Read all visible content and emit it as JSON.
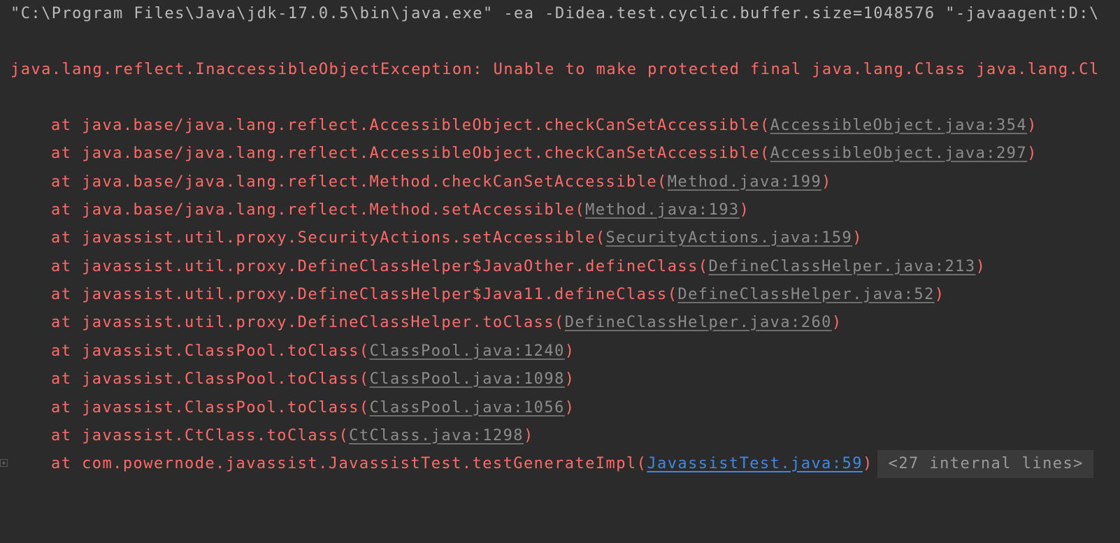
{
  "console": {
    "command_line": "\"C:\\Program Files\\Java\\jdk-17.0.5\\bin\\java.exe\" -ea -Didea.test.cyclic.buffer.size=1048576 \"-javaagent:D:\\",
    "exception_line": "java.lang.reflect.InaccessibleObjectException: Unable to make protected final java.lang.Class java.lang.Cl",
    "stack_trace": [
      {
        "prefix": "at java.base/java.lang.reflect.AccessibleObject.checkCanSetAccessible(",
        "link": "AccessibleObject.java:354",
        "suffix": ")"
      },
      {
        "prefix": "at java.base/java.lang.reflect.AccessibleObject.checkCanSetAccessible(",
        "link": "AccessibleObject.java:297",
        "suffix": ")"
      },
      {
        "prefix": "at java.base/java.lang.reflect.Method.checkCanSetAccessible(",
        "link": "Method.java:199",
        "suffix": ")"
      },
      {
        "prefix": "at java.base/java.lang.reflect.Method.setAccessible(",
        "link": "Method.java:193",
        "suffix": ")"
      },
      {
        "prefix": "at javassist.util.proxy.SecurityActions.setAccessible(",
        "link": "SecurityActions.java:159",
        "suffix": ")"
      },
      {
        "prefix": "at javassist.util.proxy.DefineClassHelper$JavaOther.defineClass(",
        "link": "DefineClassHelper.java:213",
        "suffix": ")"
      },
      {
        "prefix": "at javassist.util.proxy.DefineClassHelper$Java11.defineClass(",
        "link": "DefineClassHelper.java:52",
        "suffix": ")"
      },
      {
        "prefix": "at javassist.util.proxy.DefineClassHelper.toClass(",
        "link": "DefineClassHelper.java:260",
        "suffix": ")"
      },
      {
        "prefix": "at javassist.ClassPool.toClass(",
        "link": "ClassPool.java:1240",
        "suffix": ")"
      },
      {
        "prefix": "at javassist.ClassPool.toClass(",
        "link": "ClassPool.java:1098",
        "suffix": ")"
      },
      {
        "prefix": "at javassist.ClassPool.toClass(",
        "link": "ClassPool.java:1056",
        "suffix": ")"
      },
      {
        "prefix": "at javassist.CtClass.toClass(",
        "link": "CtClass.java:1298",
        "suffix": ")"
      },
      {
        "prefix": "at com.powernode.javassist.JavassistTest.testGenerateImpl(",
        "link": "JavassistTest.java:59",
        "suffix": ")"
      }
    ],
    "folded_label": "<27 internal lines>",
    "colors": {
      "background": "#2b2b2b",
      "command_text": "#bbbbbb",
      "error_text": "#ff6b68",
      "library_link": "#8c8c8c",
      "user_link": "#3d8ae6",
      "fold_background": "#3a3a3a"
    }
  }
}
